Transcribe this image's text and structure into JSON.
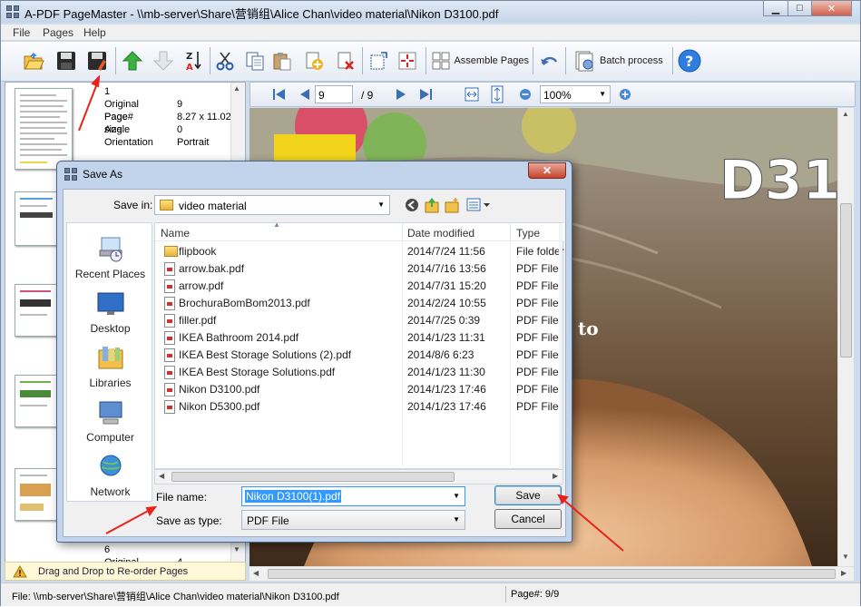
{
  "window": {
    "title": "A-PDF PageMaster - \\\\mb-server\\Share\\营销组\\Alice Chan\\video material\\Nikon D3100.pdf",
    "minimize": "▁",
    "maximize": "□",
    "close": "✕"
  },
  "menu": [
    "File",
    "Pages",
    "Help"
  ],
  "toolbar": {
    "assemble_label": "Assemble Pages",
    "batch_label": "Batch process",
    "icons": [
      "open-folder-icon",
      "save-icon",
      "save-as-icon",
      "move-up-icon",
      "move-down-icon",
      "sort-az-icon",
      "cut-icon",
      "copy-icon",
      "paste-icon",
      "insert-page-icon",
      "delete-page-icon",
      "extract-icon",
      "crop-icon",
      "assemble-icon",
      "undo-icon",
      "batch-icon",
      "help-icon"
    ]
  },
  "thumbs": {
    "page_info": {
      "number": "1",
      "rows": [
        {
          "k": "Original Page#",
          "v": "9"
        },
        {
          "k": "Page size",
          "v": "8.27 x 11.02"
        },
        {
          "k": "Angle",
          "v": "0"
        },
        {
          "k": "Orientation",
          "v": "Portrait"
        }
      ]
    },
    "page6": {
      "number": "6",
      "k": "Original Page#",
      "v": "4"
    },
    "hint": "Drag and Drop to Re-order Pages"
  },
  "nav": {
    "page_value": "9",
    "page_total": "/ 9",
    "zoom": "100%"
  },
  "viewer": {
    "heading_text": "D31",
    "overlay_text": "to"
  },
  "status": {
    "file": "File: \\\\mb-server\\Share\\营销组\\Alice Chan\\video material\\Nikon D3100.pdf",
    "page": "Page#: 9/9"
  },
  "dialog": {
    "title": "Save As",
    "save_in_label": "Save in:",
    "save_in_value": "video material",
    "places": [
      "Recent Places",
      "Desktop",
      "Libraries",
      "Computer",
      "Network"
    ],
    "columns": [
      "Name",
      "Date modified",
      "Type"
    ],
    "files": [
      {
        "name": "flipbook",
        "date": "2014/7/24 11:56",
        "type": "File folder",
        "kind": "folder"
      },
      {
        "name": "arrow.bak.pdf",
        "date": "2014/7/16 13:56",
        "type": "PDF File",
        "kind": "pdf"
      },
      {
        "name": "arrow.pdf",
        "date": "2014/7/31 15:20",
        "type": "PDF File",
        "kind": "pdf"
      },
      {
        "name": "BrochuraBomBom2013.pdf",
        "date": "2014/2/24 10:55",
        "type": "PDF File",
        "kind": "pdf"
      },
      {
        "name": "filler.pdf",
        "date": "2014/7/25 0:39",
        "type": "PDF File",
        "kind": "pdf"
      },
      {
        "name": "IKEA Bathroom 2014.pdf",
        "date": "2014/1/23 11:31",
        "type": "PDF File",
        "kind": "pdf"
      },
      {
        "name": "IKEA Best Storage Solutions (2).pdf",
        "date": "2014/8/6 6:23",
        "type": "PDF File",
        "kind": "pdf"
      },
      {
        "name": "IKEA Best Storage Solutions.pdf",
        "date": "2014/1/23 11:30",
        "type": "PDF File",
        "kind": "pdf"
      },
      {
        "name": "Nikon D3100.pdf",
        "date": "2014/1/23 17:46",
        "type": "PDF File",
        "kind": "pdf"
      },
      {
        "name": "Nikon D5300.pdf",
        "date": "2014/1/23 17:46",
        "type": "PDF File",
        "kind": "pdf"
      }
    ],
    "file_name_label": "File name:",
    "file_name_value": "Nikon D3100(1).pdf",
    "save_type_label": "Save as type:",
    "save_type_value": "PDF File",
    "save_button": "Save",
    "cancel_button": "Cancel"
  },
  "colors": {
    "accent": "#3399ff",
    "arrow": "#e8231a",
    "titlebar": "#c6d6ea"
  }
}
